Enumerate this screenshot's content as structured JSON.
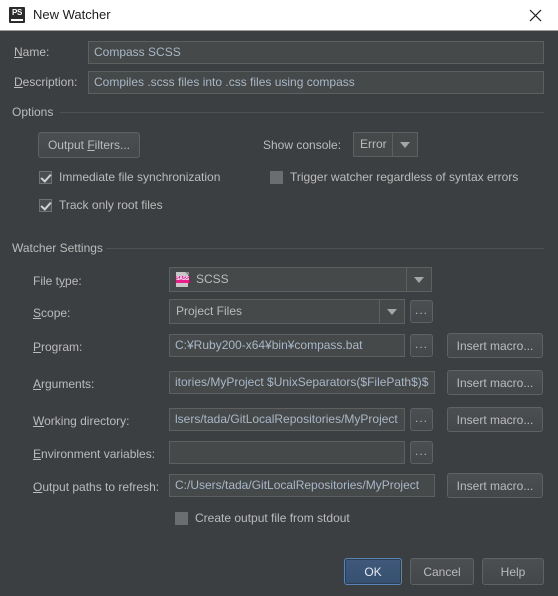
{
  "window": {
    "title": "New Watcher",
    "app_icon": "phpstorm-icon",
    "close_icon": "close-icon"
  },
  "form": {
    "name_label": "Name:",
    "name_mnemonic": "N",
    "name_value": "Compass SCSS",
    "description_label": "Description:",
    "description_mnemonic": "D",
    "description_value": "Compiles .scss files into .css files using compass"
  },
  "options": {
    "group_title": "Options",
    "output_filters_button": "Output Filters...",
    "output_filters_mnemonic": "F",
    "show_console_label": "Show console:",
    "show_console_value": "Error",
    "show_console_options": [
      "Error"
    ],
    "checkboxes": [
      {
        "label": "Immediate file synchronization",
        "checked": true
      },
      {
        "label": "Trigger watcher regardless of syntax errors",
        "checked": false
      },
      {
        "label": "Track only root files",
        "checked": true
      }
    ]
  },
  "watcher_settings": {
    "group_title": "Watcher Settings",
    "file_type_label": "File type:",
    "file_type_mnemonic": "y",
    "file_type_value": "SCSS",
    "file_type_icon": "scss-file-icon",
    "file_type_icon_text": "SASS",
    "scope_label": "Scope:",
    "scope_mnemonic": "S",
    "scope_value": "Project Files",
    "program_label": "Program:",
    "program_mnemonic": "P",
    "program_value": "C:¥Ruby200-x64¥bin¥compass.bat",
    "arguments_label": "Arguments:",
    "arguments_mnemonic": "A",
    "arguments_value": "itories/MyProject $UnixSeparators($FilePath$)$",
    "working_directory_label": "Working directory:",
    "working_directory_mnemonic": "W",
    "working_directory_value": "lsers/tada/GitLocalRepositories/MyProject",
    "environment_variables_label": "Environment variables:",
    "environment_variables_mnemonic": "E",
    "environment_variables_value": "",
    "output_paths_label": "Output paths to refresh:",
    "output_paths_mnemonic": "O",
    "output_paths_value": "C:/Users/tada/GitLocalRepositories/MyProject",
    "insert_macro_button": "Insert macro...",
    "browse_button": "...",
    "create_output_checkbox": {
      "label": "Create output file from stdout",
      "checked": false
    }
  },
  "footer": {
    "ok_label": "OK",
    "cancel_label": "Cancel",
    "help_label": "Help"
  },
  "colors": {
    "dialog_bg": "#3c3f41",
    "titlebar_bg": "#ffffff",
    "field_bg": "#45494a",
    "text": "#bbbbbb",
    "field_text": "#a9b7c6",
    "accent_blue": "#40597c",
    "accent_border": "#5a84b8",
    "sass_pink": "#e91e8c"
  }
}
